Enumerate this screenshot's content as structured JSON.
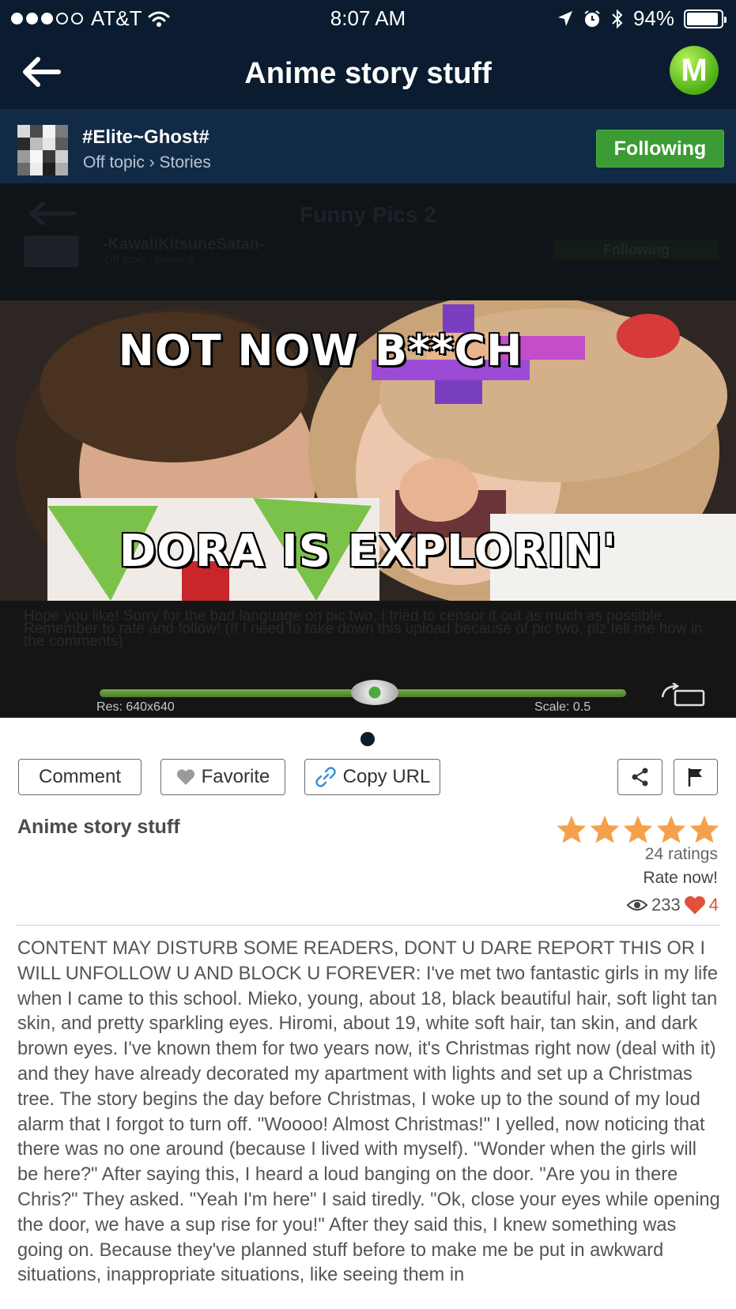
{
  "status_bar": {
    "carrier": "AT&T",
    "time": "8:07 AM",
    "battery": "94%",
    "battery_level": 0.94
  },
  "nav": {
    "title": "Anime story stuff",
    "badge_letter": "M"
  },
  "author": {
    "name": "#Elite~Ghost#",
    "category": "Off topic › Stories",
    "follow_label": "Following"
  },
  "media": {
    "background_post_title": "Funny Pics 2",
    "background_post_author": "-KawaiiKitsuneSatan-",
    "background_post_category": "Off topic › General",
    "background_post_follow_label": "Following",
    "caption_top": "NOT NOW B**CH",
    "caption_bottom": "DORA IS EXPLORIN'",
    "background_description": "Hope you like! Sorry for the bad language on pic two, I tried to censor it out as much as possible. Remember to rate and follow! (If I need to take down this upload because of pic two, plz tell me how in the comments)",
    "resolution": "Res: 640x640",
    "scale": "Scale: 0.5",
    "scale_level": 0.5
  },
  "actions": {
    "comment_label": "Comment",
    "favorite_label": "Favorite",
    "copy_url_label": "Copy URL"
  },
  "post": {
    "title": "Anime story stuff",
    "rating_stars": 5,
    "ratings_count": "24 ratings",
    "rate_now": "Rate now!",
    "views": "233",
    "likes": "4",
    "body": "CONTENT MAY DISTURB SOME READERS, DONT U DARE REPORT THIS OR I WILL UNFOLLOW U AND BLOCK U FOREVER: I've met two fantastic girls in my life when I came to this school. Mieko, young, about 18, black beautiful hair, soft light tan skin, and pretty sparkling eyes. Hiromi, about 19, white soft hair, tan skin, and dark brown eyes. I've known them for two years now, it's Christmas right now (deal with it) and they have already decorated my apartment with lights and set up a Christmas tree. The story begins the day before Christmas, I woke up to the sound of my loud alarm that I forgot to turn off. \"Woooo! Almost Christmas!\" I yelled, now noticing that there was no one around (because I lived with myself). \"Wonder when the girls will be here?\" After saying this, I heard a loud banging on the door. \"Are you in there Chris?\" They asked. \"Yeah I'm here\" I said tiredly. \"Ok, close your eyes while opening the door, we have a sup rise for you!\" After they said this, I knew something was going on. Because they've planned stuff before to make me be put in awkward situations, inappropriate situations, like seeing them in"
  },
  "colors": {
    "nav_bg": "#0b1c30",
    "follow_green": "#3d9b35",
    "star_orange": "#f5a04a",
    "like_red": "#e0503a"
  }
}
